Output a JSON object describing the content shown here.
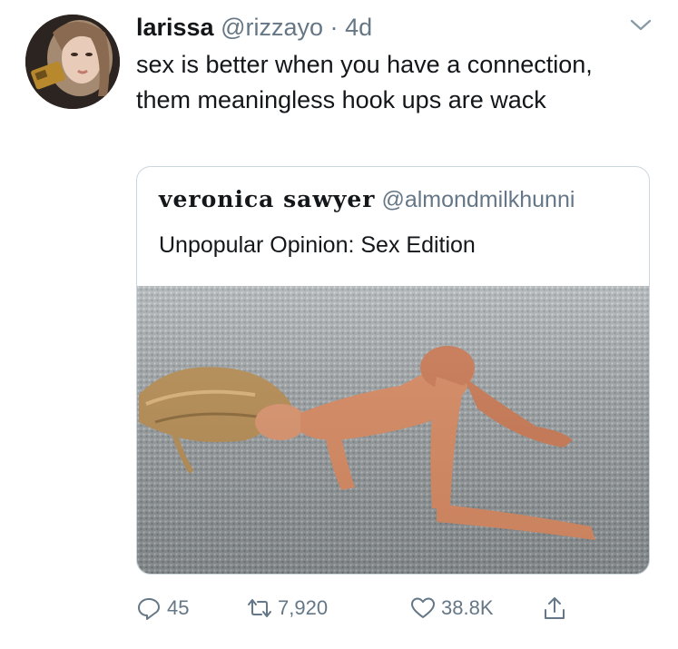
{
  "tweet": {
    "author_name": "larissa",
    "handle": "@rizzayo",
    "separator": "·",
    "age": "4d",
    "text": "sex is better when you have a connection, them meaningless hook ups are wack"
  },
  "quoted_tweet": {
    "author_name": "veronica sawyer",
    "handle": "@almondmilkhunni",
    "text": "Unpopular Opinion: Sex Edition",
    "image_alt_icon": "photo-doll-on-carpet"
  },
  "actions": {
    "replies": "45",
    "retweets": "7,920",
    "likes": "38.8K"
  },
  "icons": {
    "caret": "chevron-down-icon",
    "reply": "reply-icon",
    "retweet": "retweet-icon",
    "like": "heart-icon",
    "share": "share-icon"
  },
  "colors": {
    "text": "#14171a",
    "secondary": "#657786",
    "border": "#ccd6dd"
  }
}
